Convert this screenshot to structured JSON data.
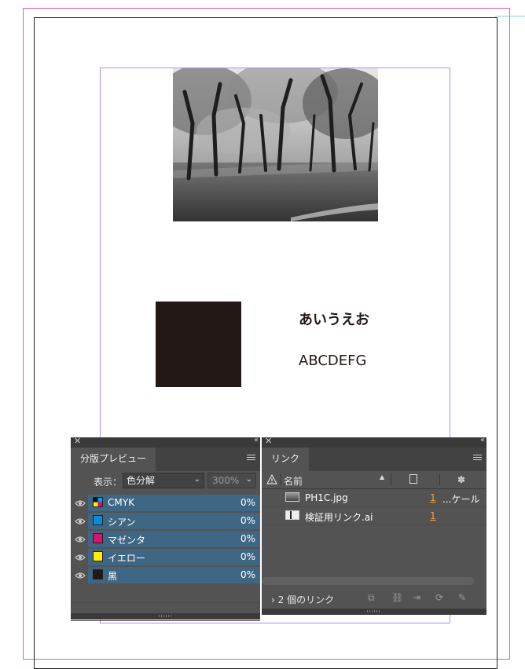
{
  "canvas": {
    "text_jp": "あいうえお",
    "text_en": "ABCDEFG",
    "square_color": "#231816"
  },
  "separations_panel": {
    "tab_label": "分版プレビュー",
    "view_label": "表示：",
    "view_value": "色分解",
    "zoom_value": "300%",
    "rows": [
      {
        "name": "CMYK",
        "value": "0%",
        "chip": "cmyk"
      },
      {
        "name": "シアン",
        "value": "0%",
        "chip": "#0a8ad8"
      },
      {
        "name": "マゼンタ",
        "value": "0%",
        "chip": "#d4146e"
      },
      {
        "name": "イエロー",
        "value": "0%",
        "chip": "#ffee00"
      },
      {
        "name": "黒",
        "value": "0%",
        "chip": "#231816"
      }
    ]
  },
  "links_panel": {
    "tab_label": "リンク",
    "column_name": "名前",
    "rows": [
      {
        "name": "PH1C.jpg",
        "page": "1",
        "status": "...ケール"
      },
      {
        "name": "検証用リンク.ai",
        "page": "1",
        "status": ""
      }
    ],
    "footer_count": "2 個のリンク"
  },
  "icons": {
    "close": "close-icon",
    "collapse": "collapse-icon",
    "menu": "panel-menu-icon",
    "eye": "eye-icon",
    "warning": "warning-icon",
    "relink": "relink-icon",
    "goto": "goto-link-icon",
    "update": "update-link-icon",
    "edit": "edit-original-icon"
  }
}
